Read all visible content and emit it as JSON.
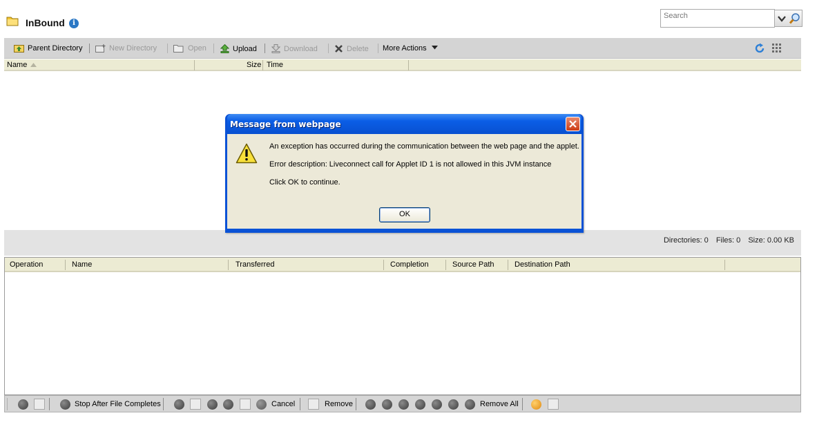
{
  "header": {
    "title": "InBound",
    "search_placeholder": "Search"
  },
  "toolbar": {
    "parent_directory": "Parent Directory",
    "new_directory": "New Directory",
    "open": "Open",
    "upload": "Upload",
    "download": "Download",
    "delete": "Delete",
    "more_actions": "More Actions"
  },
  "file_list": {
    "columns": [
      "Name",
      "Size",
      "Time"
    ]
  },
  "status": {
    "directories": "Directories: 0",
    "files": "Files: 0",
    "size": "Size: 0.00 KB"
  },
  "transfer": {
    "columns": [
      "Operation",
      "Name",
      "Transferred",
      "Completion",
      "Source Path",
      "Destination Path"
    ]
  },
  "controls": {
    "stop_after": "Stop After File Completes",
    "cancel": "Cancel",
    "remove": "Remove",
    "remove_all": "Remove All"
  },
  "dialog": {
    "title": "Message from webpage",
    "line1": "An exception has occurred during the communication between the web page and the applet.",
    "line2": "Error description: Liveconnect call for Applet ID 1 is not allowed in this JVM instance",
    "line3": "Click OK to continue.",
    "ok": "OK"
  },
  "colors": {
    "dialog_blue": "#0a52d6",
    "dialog_body": "#ece9d8",
    "toolbar_bg": "#d4d4d4",
    "header_row": "#ecebd3"
  }
}
